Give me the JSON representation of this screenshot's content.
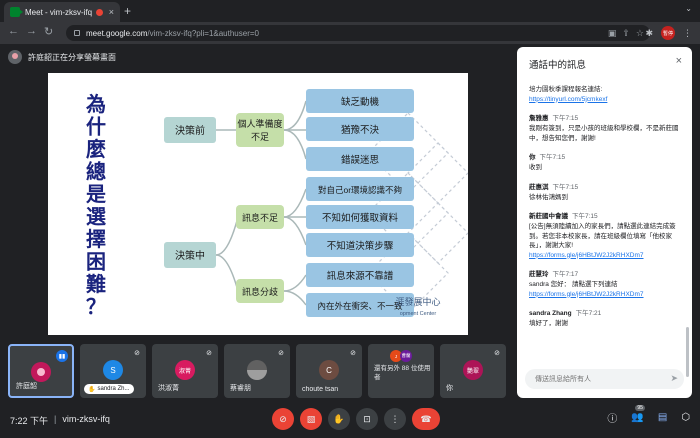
{
  "browser": {
    "tab_title": "Meet - vim-zksv-ifq",
    "tab_close": "×",
    "new_tab": "+",
    "url_host": "meet.google.com",
    "url_path": "/vim-zksv-ifq?pli=1&authuser=0",
    "profile_label": "暫停"
  },
  "meeting": {
    "presenting_banner": "許庭韶正在分享螢幕畫面",
    "time": "7:22 下午",
    "separator": "|",
    "code": "vim-zksv-ifq",
    "participant_count": "95"
  },
  "slide": {
    "title_chars": [
      "為",
      "什",
      "麼",
      "總",
      "是",
      "選",
      "擇",
      "困",
      "難",
      "？"
    ],
    "root_1": "決策前",
    "root_2": "決策中",
    "branch_1": "個人準備度不足",
    "branch_1_lines": [
      "個人準備度",
      "不足"
    ],
    "branch_2": "訊息不足",
    "branch_3": "訊息分歧",
    "leaves": [
      "缺乏動機",
      "猶豫不決",
      "錯誤迷思",
      "對自己or環境認識不夠",
      "不知如何獲取資料",
      "不知道決策步驟",
      "訊息來源不靠譜",
      "內在外在衝突、不一致"
    ],
    "watermark_1": "涯發展中心",
    "watermark_2": "opment Center"
  },
  "tiles": [
    {
      "name": "許庭韶",
      "avatar_color": "#c2185b",
      "avatar_text": ""
    },
    {
      "name": "sandra Zh...",
      "avatar_color": "#1e88e5",
      "avatar_text": "S"
    },
    {
      "name": "洪淑菁",
      "avatar_color": "#d81b60",
      "avatar_text": "淑菁"
    },
    {
      "name": "蔡睿朋",
      "avatar_color": "#616161",
      "avatar_text": ""
    },
    {
      "name": "choute tsan",
      "avatar_color": "#6d4c41",
      "avatar_text": "C"
    },
    {
      "name": "還有另外 88 位使用者",
      "avatar_color": "#e64a19",
      "avatar_text": "J"
    },
    {
      "name": "你",
      "avatar_color": "#ad1457",
      "avatar_text": "艷翠"
    }
  ],
  "tile_mini_avatars": [
    {
      "text": "J",
      "color": "#e64a19"
    },
    {
      "text": "曹蘭",
      "color": "#6a1b9a"
    }
  ],
  "chat": {
    "header": "通話中的訊息",
    "close": "×",
    "messages": [
      {
        "sender": "",
        "time": "",
        "body": "培力園秋季課程報名連結:",
        "link": "https://tinyurl.com/5jcmkexf"
      },
      {
        "sender": "詹雅惠",
        "time": "下午7:15",
        "body": "我剛有簽到，只是小孩的班級和學校欄，不是新莊國中，想告知您們，謝謝!",
        "link": ""
      },
      {
        "sender": "你",
        "time": "下午7:15",
        "body": "收到",
        "link": ""
      },
      {
        "sender": "莊惠淇",
        "time": "下午7:15",
        "body": "徐林佑鴻媽到",
        "link": ""
      },
      {
        "sender": "新莊國中會議",
        "time": "下午7:15",
        "body": "[公告]無須陸續加入的家長們，請點選此連結完成簽到。若您非本校家長，請在班級欄位填寫「他校家長」，謝謝大家!",
        "link": "https://forms.gle/j6HBtJW2J2kRHXDm7"
      },
      {
        "sender": "莊慧玲",
        "time": "下午7:17",
        "body": "sandra 您好： 請點選下列連結",
        "link": "https://forms.gle/j6HBtJW2J2kRHXDm7"
      },
      {
        "sender": "sandra Zhang",
        "time": "下午7:21",
        "body": "填好了，謝謝",
        "link": ""
      }
    ],
    "input_placeholder": "傳送訊息給所有人"
  },
  "colors": {
    "root_fill": "#b5d5d3",
    "branch_fill": "#c5dfa9",
    "leaf_fill": "#9ac5e3",
    "title_color": "#1a237e"
  }
}
